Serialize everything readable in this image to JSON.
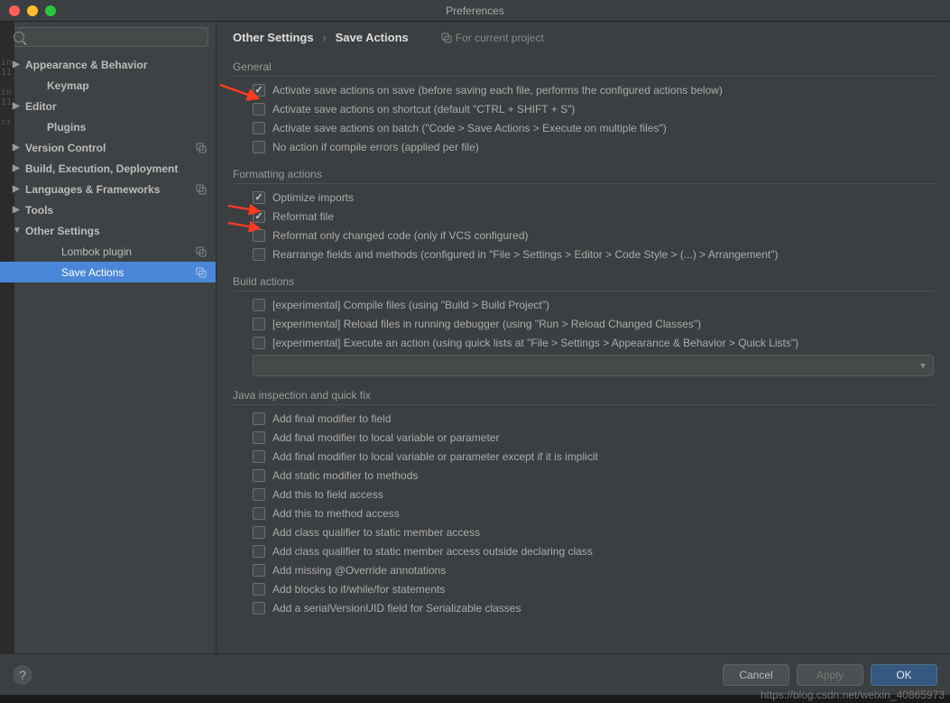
{
  "window": {
    "title": "Preferences"
  },
  "sidebar": {
    "search_placeholder": "",
    "items": [
      {
        "label": "Appearance & Behavior",
        "bold": true,
        "arrow": "▶"
      },
      {
        "label": "Keymap",
        "bold": true,
        "arrow": "",
        "child": true
      },
      {
        "label": "Editor",
        "bold": true,
        "arrow": "▶"
      },
      {
        "label": "Plugins",
        "bold": true,
        "arrow": "",
        "child": true
      },
      {
        "label": "Version Control",
        "bold": true,
        "arrow": "▶",
        "copy": true
      },
      {
        "label": "Build, Execution, Deployment",
        "bold": true,
        "arrow": "▶"
      },
      {
        "label": "Languages & Frameworks",
        "bold": true,
        "arrow": "▶",
        "copy": true
      },
      {
        "label": "Tools",
        "bold": true,
        "arrow": "▶"
      },
      {
        "label": "Other Settings",
        "bold": true,
        "arrow": "▼"
      },
      {
        "label": "Lombok plugin",
        "bold": false,
        "arrow": "",
        "child2": true,
        "copy": true
      },
      {
        "label": "Save Actions",
        "bold": false,
        "arrow": "",
        "child2": true,
        "copy": true,
        "selected": true
      }
    ]
  },
  "breadcrumb": {
    "a": "Other Settings",
    "b": "Save Actions",
    "scope": "For current project"
  },
  "sections": {
    "general": {
      "title": "General",
      "items": [
        {
          "checked": true,
          "label": "Activate save actions on save (before saving each file, performs the configured actions below)"
        },
        {
          "checked": false,
          "label": "Activate save actions on shortcut (default \"CTRL + SHIFT + S\")"
        },
        {
          "checked": false,
          "label": "Activate save actions on batch (\"Code > Save Actions > Execute on multiple files\")"
        },
        {
          "checked": false,
          "label": "No action if compile errors (applied per file)"
        }
      ]
    },
    "formatting": {
      "title": "Formatting actions",
      "items": [
        {
          "checked": true,
          "label": "Optimize imports"
        },
        {
          "checked": true,
          "label": "Reformat file"
        },
        {
          "checked": false,
          "label": "Reformat only changed code (only if VCS configured)"
        },
        {
          "checked": false,
          "label": "Rearrange fields and methods (configured in \"File > Settings > Editor > Code Style > (...) > Arrangement\")"
        }
      ]
    },
    "build": {
      "title": "Build actions",
      "items": [
        {
          "checked": false,
          "label": "[experimental] Compile files (using \"Build > Build Project\")"
        },
        {
          "checked": false,
          "label": "[experimental] Reload files in running debugger (using \"Run > Reload Changed Classes\")"
        },
        {
          "checked": false,
          "label": "[experimental] Execute an action (using quick lists at \"File > Settings > Appearance & Behavior > Quick Lists\")"
        }
      ]
    },
    "java": {
      "title": "Java inspection and quick fix",
      "items": [
        {
          "checked": false,
          "label": "Add final modifier to field"
        },
        {
          "checked": false,
          "label": "Add final modifier to local variable or parameter"
        },
        {
          "checked": false,
          "label": "Add final modifier to local variable or parameter except if it is implicit"
        },
        {
          "checked": false,
          "label": "Add static modifier to methods"
        },
        {
          "checked": false,
          "label": "Add this to field access"
        },
        {
          "checked": false,
          "label": "Add this to method access"
        },
        {
          "checked": false,
          "label": "Add class qualifier to static member access"
        },
        {
          "checked": false,
          "label": "Add class qualifier to static member access outside declaring class"
        },
        {
          "checked": false,
          "label": "Add missing @Override annotations"
        },
        {
          "checked": false,
          "label": "Add blocks to if/while/for statements"
        },
        {
          "checked": false,
          "label": "Add a serialVersionUID field for Serializable classes"
        }
      ]
    }
  },
  "footer": {
    "cancel": "Cancel",
    "apply": "Apply",
    "ok": "OK"
  },
  "watermark": "https://blog.csdn.net/weixin_40865973"
}
